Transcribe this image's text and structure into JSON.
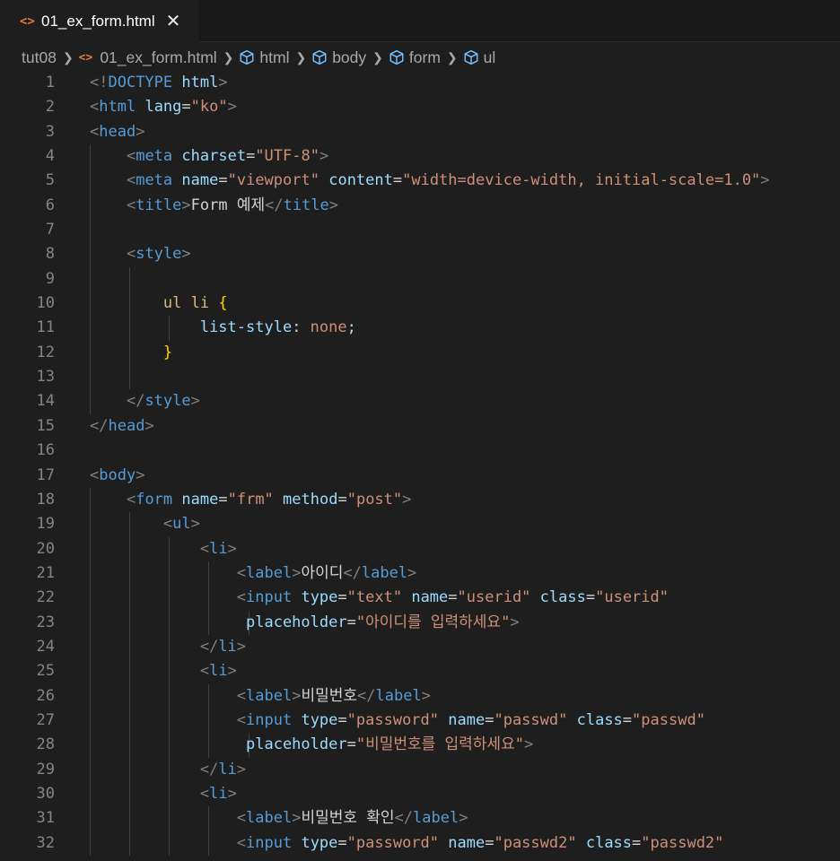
{
  "tab": {
    "filename": "01_ex_form.html",
    "close_glyph": "✕",
    "file_icon_glyph": "<>"
  },
  "breadcrumb": {
    "folder": "tut08",
    "file": "01_ex_form.html",
    "symbols": [
      "html",
      "body",
      "form",
      "ul"
    ]
  },
  "colors": {
    "tag": "#569cd6",
    "attribute": "#9cdcfe",
    "string": "#ce9178",
    "bracket": "#808080",
    "selector": "#d7ba7d",
    "brace": "#ffd700",
    "line_number": "#858585",
    "background": "#1e1e1e",
    "file_icon": "#e37933"
  },
  "lines": [
    {
      "n": "1",
      "g": 0,
      "tokens": [
        [
          "t",
          "<!"
        ],
        [
          "tag",
          "DOCTYPE"
        ],
        [
          "tx",
          " "
        ],
        [
          "at",
          "html"
        ],
        [
          "t",
          ">"
        ]
      ]
    },
    {
      "n": "2",
      "g": 0,
      "tokens": [
        [
          "t",
          "<"
        ],
        [
          "tag",
          "html"
        ],
        [
          "tx",
          " "
        ],
        [
          "at",
          "lang"
        ],
        [
          "tx",
          "="
        ],
        [
          "st",
          "\"ko\""
        ],
        [
          "t",
          ">"
        ]
      ]
    },
    {
      "n": "3",
      "g": 0,
      "tokens": [
        [
          "t",
          "<"
        ],
        [
          "tag",
          "head"
        ],
        [
          "t",
          ">"
        ]
      ]
    },
    {
      "n": "4",
      "g": 1,
      "tokens": [
        [
          "tx",
          "    "
        ],
        [
          "t",
          "<"
        ],
        [
          "tag",
          "meta"
        ],
        [
          "tx",
          " "
        ],
        [
          "at",
          "charset"
        ],
        [
          "tx",
          "="
        ],
        [
          "st",
          "\"UTF-8\""
        ],
        [
          "t",
          ">"
        ]
      ]
    },
    {
      "n": "5",
      "g": 1,
      "tokens": [
        [
          "tx",
          "    "
        ],
        [
          "t",
          "<"
        ],
        [
          "tag",
          "meta"
        ],
        [
          "tx",
          " "
        ],
        [
          "at",
          "name"
        ],
        [
          "tx",
          "="
        ],
        [
          "st",
          "\"viewport\""
        ],
        [
          "tx",
          " "
        ],
        [
          "at",
          "content"
        ],
        [
          "tx",
          "="
        ],
        [
          "st",
          "\"width=device-width, initial-scale=1.0\""
        ],
        [
          "t",
          ">"
        ]
      ]
    },
    {
      "n": "6",
      "g": 1,
      "tokens": [
        [
          "tx",
          "    "
        ],
        [
          "t",
          "<"
        ],
        [
          "tag",
          "title"
        ],
        [
          "t",
          ">"
        ],
        [
          "tx",
          "Form 예제"
        ],
        [
          "t",
          "</"
        ],
        [
          "tag",
          "title"
        ],
        [
          "t",
          ">"
        ]
      ]
    },
    {
      "n": "7",
      "g": 1,
      "tokens": []
    },
    {
      "n": "8",
      "g": 1,
      "tokens": [
        [
          "tx",
          "    "
        ],
        [
          "t",
          "<"
        ],
        [
          "tag",
          "style"
        ],
        [
          "t",
          ">"
        ]
      ]
    },
    {
      "n": "9",
      "g": 2,
      "tokens": []
    },
    {
      "n": "10",
      "g": 2,
      "tokens": [
        [
          "tx",
          "        "
        ],
        [
          "sel",
          "ul li"
        ],
        [
          "tx",
          " "
        ],
        [
          "br",
          "{"
        ]
      ]
    },
    {
      "n": "11",
      "g": 3,
      "tokens": [
        [
          "tx",
          "            "
        ],
        [
          "pr",
          "list-style"
        ],
        [
          "tx",
          ": "
        ],
        [
          "vl",
          "none"
        ],
        [
          "tx",
          ";"
        ]
      ]
    },
    {
      "n": "12",
      "g": 2,
      "tokens": [
        [
          "tx",
          "        "
        ],
        [
          "br",
          "}"
        ]
      ]
    },
    {
      "n": "13",
      "g": 2,
      "tokens": []
    },
    {
      "n": "14",
      "g": 1,
      "tokens": [
        [
          "tx",
          "    "
        ],
        [
          "t",
          "</"
        ],
        [
          "tag",
          "style"
        ],
        [
          "t",
          ">"
        ]
      ]
    },
    {
      "n": "15",
      "g": 0,
      "tokens": [
        [
          "t",
          "</"
        ],
        [
          "tag",
          "head"
        ],
        [
          "t",
          ">"
        ]
      ]
    },
    {
      "n": "16",
      "g": 0,
      "tokens": []
    },
    {
      "n": "17",
      "g": 0,
      "tokens": [
        [
          "t",
          "<"
        ],
        [
          "tag",
          "body"
        ],
        [
          "t",
          ">"
        ]
      ]
    },
    {
      "n": "18",
      "g": 1,
      "tokens": [
        [
          "tx",
          "    "
        ],
        [
          "t",
          "<"
        ],
        [
          "tag",
          "form"
        ],
        [
          "tx",
          " "
        ],
        [
          "at",
          "name"
        ],
        [
          "tx",
          "="
        ],
        [
          "st",
          "\"frm\""
        ],
        [
          "tx",
          " "
        ],
        [
          "at",
          "method"
        ],
        [
          "tx",
          "="
        ],
        [
          "st",
          "\"post\""
        ],
        [
          "t",
          ">"
        ]
      ]
    },
    {
      "n": "19",
      "g": 2,
      "tokens": [
        [
          "tx",
          "        "
        ],
        [
          "t",
          "<"
        ],
        [
          "tag",
          "ul"
        ],
        [
          "t",
          ">"
        ]
      ]
    },
    {
      "n": "20",
      "g": 3,
      "tokens": [
        [
          "tx",
          "            "
        ],
        [
          "t",
          "<"
        ],
        [
          "tag",
          "li"
        ],
        [
          "t",
          ">"
        ]
      ]
    },
    {
      "n": "21",
      "g": 4,
      "tokens": [
        [
          "tx",
          "                "
        ],
        [
          "t",
          "<"
        ],
        [
          "tag",
          "label"
        ],
        [
          "t",
          ">"
        ],
        [
          "tx",
          "아이디"
        ],
        [
          "t",
          "</"
        ],
        [
          "tag",
          "label"
        ],
        [
          "t",
          ">"
        ]
      ]
    },
    {
      "n": "22",
      "g": 4,
      "tokens": [
        [
          "tx",
          "                "
        ],
        [
          "t",
          "<"
        ],
        [
          "tag",
          "input"
        ],
        [
          "tx",
          " "
        ],
        [
          "at",
          "type"
        ],
        [
          "tx",
          "="
        ],
        [
          "st",
          "\"text\""
        ],
        [
          "tx",
          " "
        ],
        [
          "at",
          "name"
        ],
        [
          "tx",
          "="
        ],
        [
          "st",
          "\"userid\""
        ],
        [
          "tx",
          " "
        ],
        [
          "at",
          "class"
        ],
        [
          "tx",
          "="
        ],
        [
          "st",
          "\"userid\""
        ]
      ]
    },
    {
      "n": "23",
      "g": 5,
      "tokens": [
        [
          "tx",
          "                 "
        ],
        [
          "at",
          "placeholder"
        ],
        [
          "tx",
          "="
        ],
        [
          "st",
          "\"아이디를 입력하세요\""
        ],
        [
          "t",
          ">"
        ]
      ]
    },
    {
      "n": "24",
      "g": 3,
      "tokens": [
        [
          "tx",
          "            "
        ],
        [
          "t",
          "</"
        ],
        [
          "tag",
          "li"
        ],
        [
          "t",
          ">"
        ]
      ]
    },
    {
      "n": "25",
      "g": 3,
      "tokens": [
        [
          "tx",
          "            "
        ],
        [
          "t",
          "<"
        ],
        [
          "tag",
          "li"
        ],
        [
          "t",
          ">"
        ]
      ]
    },
    {
      "n": "26",
      "g": 4,
      "tokens": [
        [
          "tx",
          "                "
        ],
        [
          "t",
          "<"
        ],
        [
          "tag",
          "label"
        ],
        [
          "t",
          ">"
        ],
        [
          "tx",
          "비밀번호"
        ],
        [
          "t",
          "</"
        ],
        [
          "tag",
          "label"
        ],
        [
          "t",
          ">"
        ]
      ]
    },
    {
      "n": "27",
      "g": 4,
      "tokens": [
        [
          "tx",
          "                "
        ],
        [
          "t",
          "<"
        ],
        [
          "tag",
          "input"
        ],
        [
          "tx",
          " "
        ],
        [
          "at",
          "type"
        ],
        [
          "tx",
          "="
        ],
        [
          "st",
          "\"password\""
        ],
        [
          "tx",
          " "
        ],
        [
          "at",
          "name"
        ],
        [
          "tx",
          "="
        ],
        [
          "st",
          "\"passwd\""
        ],
        [
          "tx",
          " "
        ],
        [
          "at",
          "class"
        ],
        [
          "tx",
          "="
        ],
        [
          "st",
          "\"passwd\""
        ]
      ]
    },
    {
      "n": "28",
      "g": 5,
      "tokens": [
        [
          "tx",
          "                 "
        ],
        [
          "at",
          "placeholder"
        ],
        [
          "tx",
          "="
        ],
        [
          "st",
          "\"비밀번호를 입력하세요\""
        ],
        [
          "t",
          ">"
        ]
      ]
    },
    {
      "n": "29",
      "g": 3,
      "tokens": [
        [
          "tx",
          "            "
        ],
        [
          "t",
          "</"
        ],
        [
          "tag",
          "li"
        ],
        [
          "t",
          ">"
        ]
      ]
    },
    {
      "n": "30",
      "g": 3,
      "tokens": [
        [
          "tx",
          "            "
        ],
        [
          "t",
          "<"
        ],
        [
          "tag",
          "li"
        ],
        [
          "t",
          ">"
        ]
      ]
    },
    {
      "n": "31",
      "g": 4,
      "tokens": [
        [
          "tx",
          "                "
        ],
        [
          "t",
          "<"
        ],
        [
          "tag",
          "label"
        ],
        [
          "t",
          ">"
        ],
        [
          "tx",
          "비밀번호 확인"
        ],
        [
          "t",
          "</"
        ],
        [
          "tag",
          "label"
        ],
        [
          "t",
          ">"
        ]
      ]
    },
    {
      "n": "32",
      "g": 4,
      "tokens": [
        [
          "tx",
          "                "
        ],
        [
          "t",
          "<"
        ],
        [
          "tag",
          "input"
        ],
        [
          "tx",
          " "
        ],
        [
          "at",
          "type"
        ],
        [
          "tx",
          "="
        ],
        [
          "st",
          "\"password\""
        ],
        [
          "tx",
          " "
        ],
        [
          "at",
          "name"
        ],
        [
          "tx",
          "="
        ],
        [
          "st",
          "\"passwd2\""
        ],
        [
          "tx",
          " "
        ],
        [
          "at",
          "class"
        ],
        [
          "tx",
          "="
        ],
        [
          "st",
          "\"passwd2\""
        ]
      ]
    }
  ]
}
